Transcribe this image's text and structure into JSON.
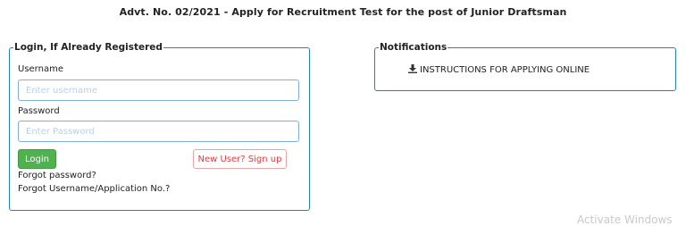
{
  "page": {
    "title": "Advt. No. 02/2021 - Apply for Recruitment Test for the post of Junior Draftsman"
  },
  "login": {
    "legend": "Login, If Already Registered",
    "username_label": "Username",
    "username_placeholder": "Enter username",
    "username_value": "",
    "password_label": "Password",
    "password_placeholder": "Enter Password",
    "password_value": "",
    "login_button": "Login",
    "signup_button": "New User? Sign up",
    "forgot_password": "Forgot password?",
    "forgot_username": "Forgot Username/Application No.?"
  },
  "notifications": {
    "legend": "Notifications",
    "items": [
      {
        "label": "INSTRUCTIONS FOR APPLYING ONLINE",
        "icon": "download-icon"
      }
    ]
  },
  "overlay": {
    "watermark": "Activate Windows"
  },
  "colors": {
    "border_accent": "#2a7fba",
    "login_button": "#4fb14f",
    "signup_text": "#e03c3c"
  }
}
